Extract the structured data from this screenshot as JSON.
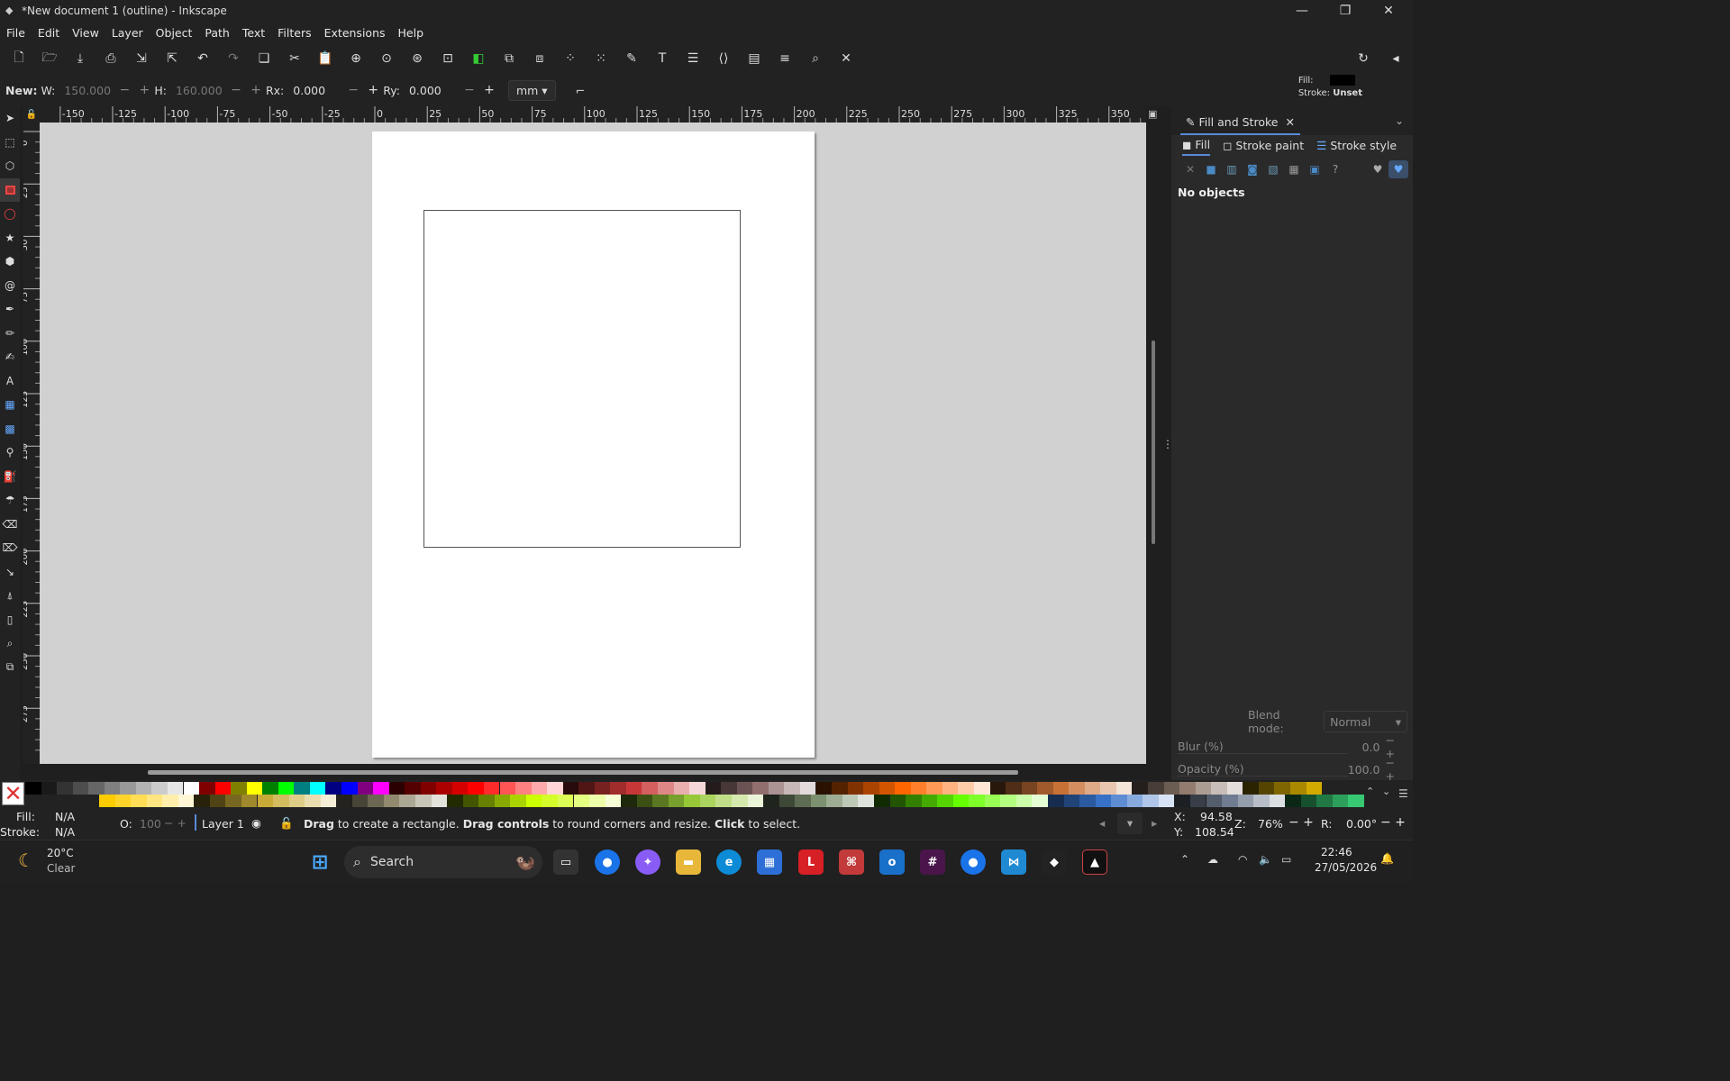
{
  "window": {
    "title": "*New document 1 (outline) - Inkscape",
    "app_icon": "inkscape-icon"
  },
  "menu": [
    "File",
    "Edit",
    "View",
    "Layer",
    "Object",
    "Path",
    "Text",
    "Filters",
    "Extensions",
    "Help"
  ],
  "commands": [
    "new-document-icon",
    "open-icon",
    "save-icon",
    "print-icon",
    "import-icon",
    "export-icon",
    "undo-icon",
    "redo-icon",
    "copy-icon",
    "cut-icon",
    "paste-icon",
    "zoom-selection-icon",
    "zoom-drawing-icon",
    "zoom-page-icon",
    "zoom-page-width-icon",
    "duplicate-icon",
    "clone-icon",
    "unlink-clone-icon",
    "group-icon",
    "ungroup-icon",
    "fill-stroke-icon",
    "text-font-icon",
    "layers-icon",
    "xml-editor-icon",
    "document-properties-icon",
    "align-distribute-icon",
    "find-replace-icon",
    "preferences-icon"
  ],
  "tool_controls": {
    "new_label": "New:",
    "w_label": "W:",
    "w_value": "150.000",
    "h_label": "H:",
    "h_value": "160.000",
    "rx_label": "Rx:",
    "rx_value": "0.000",
    "ry_label": "Ry:",
    "ry_value": "0.000",
    "unit": "mm"
  },
  "fill_stroke_indicator": {
    "fill_label": "Fill:",
    "stroke_label": "Stroke:",
    "stroke_value": "Unset",
    "fill_color": "#000000"
  },
  "tools": [
    "selector",
    "node",
    "tweak",
    "rectangle",
    "ellipse",
    "star",
    "3dbox",
    "spiral",
    "pen",
    "pencil",
    "calligraphy",
    "text",
    "gradient",
    "mesh",
    "dropper",
    "paint-bucket",
    "spray",
    "eraser",
    "eraser2",
    "connector",
    "measure",
    "pages",
    "zoom",
    "lpe"
  ],
  "ruler": {
    "h_labels": [
      "-150",
      "-125",
      "-100",
      "-75",
      "-50",
      "-25",
      "0",
      "25",
      "50",
      "75",
      "100",
      "125",
      "150",
      "175",
      "200",
      "225",
      "250",
      "275",
      "300",
      "325",
      "350"
    ],
    "v_labels": [
      "0",
      "25",
      "50",
      "75",
      "100",
      "125",
      "150",
      "175",
      "200",
      "225",
      "250",
      "275"
    ]
  },
  "dock": {
    "tab_label": "Fill and Stroke",
    "subtabs": [
      "Fill",
      "Stroke paint",
      "Stroke style"
    ],
    "no_objects": "No objects",
    "blend_label": "Blend mode:",
    "blend_value": "Normal",
    "blur_label": "Blur (%)",
    "blur_value": "0.0",
    "opacity_label": "Opacity (%)",
    "opacity_value": "100.0"
  },
  "status": {
    "fill_label": "Fill:",
    "fill_value": "N/A",
    "stroke_label": "Stroke:",
    "stroke_value": "N/A",
    "o_label": "O:",
    "o_value": "100",
    "layer": "Layer 1",
    "msg_1": "Drag",
    "msg_2": " to create a rectangle. ",
    "msg_3": "Drag controls",
    "msg_4": " to round corners and resize. ",
    "msg_5": "Click",
    "msg_6": " to select.",
    "x_label": "X:",
    "x_value": "94.58",
    "y_label": "Y:",
    "y_value": "108.54",
    "z_label": "Z:",
    "zoom": "76%",
    "r_label": "R:",
    "rotation": "0.00°"
  },
  "taskbar": {
    "weather_temp": "20°C",
    "weather_desc": "Clear",
    "search_placeholder": "Search",
    "time": "22:46",
    "date": "27/05/2026"
  }
}
